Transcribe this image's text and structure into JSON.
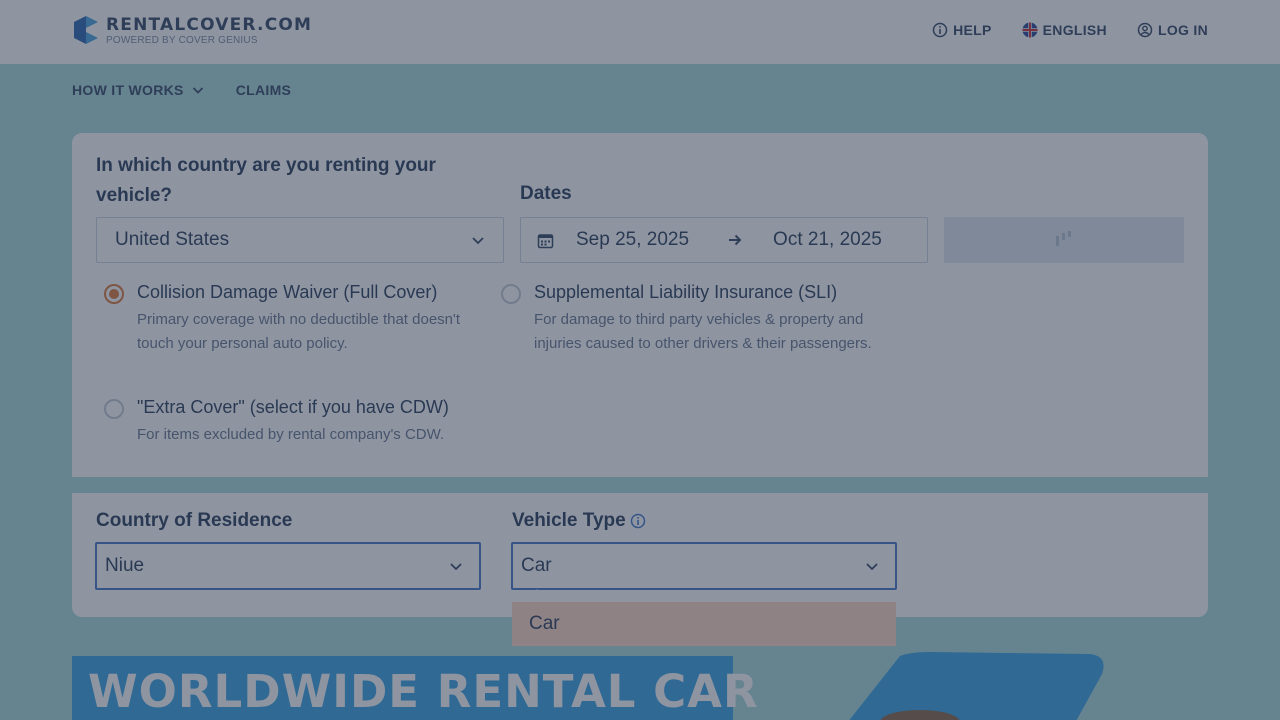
{
  "header": {
    "brand_name": "RENTALCOVER.COM",
    "brand_tagline": "POWERED BY COVER GENIUS",
    "help_label": "HELP",
    "language_label": "ENGLISH",
    "login_label": "LOG IN"
  },
  "subnav": {
    "how_it_works_label": "HOW IT WORKS",
    "claims_label": "CLAIMS"
  },
  "search": {
    "country_question": "In which country are you renting your vehicle?",
    "country_value": "United States",
    "dates_label": "Dates",
    "date_start": "Sep 25, 2025",
    "date_end": "Oct 21, 2025"
  },
  "coverage_options": [
    {
      "title": "Collision Damage Waiver (Full Cover)",
      "description": "Primary coverage with no deductible that doesn't touch your personal auto policy.",
      "selected": true
    },
    {
      "title": "Supplemental Liability Insurance (SLI)",
      "description": "For damage to third party vehicles & property and injuries caused to other drivers & their passengers.",
      "selected": false
    },
    {
      "title": "\"Extra Cover\" (select if you have CDW)",
      "description": "For items excluded by rental company's CDW.",
      "selected": false
    }
  ],
  "details": {
    "residence_label": "Country of Residence",
    "residence_value": "Niue",
    "vehicle_label": "Vehicle Type",
    "vehicle_value": "Car",
    "vehicle_options": [
      "Car"
    ]
  },
  "hero": {
    "headline": "WORLDWIDE RENTAL CAR"
  },
  "colors": {
    "accent_radio": "#e07a3d",
    "hero_blue": "#3aa3e3",
    "dropdown_highlight": "#ffd8c4",
    "page_bg": "#a9dcdc"
  }
}
